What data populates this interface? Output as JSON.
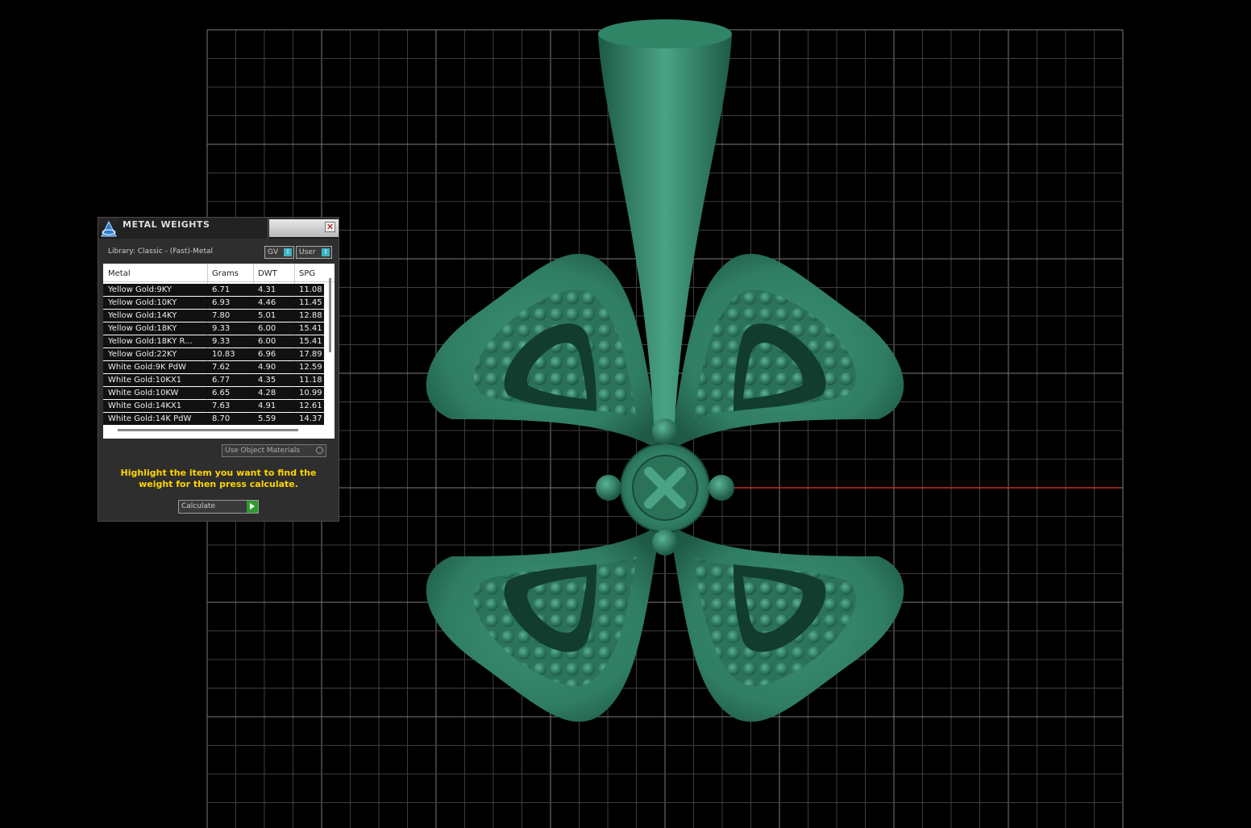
{
  "panel": {
    "title": "METAL WEIGHTS",
    "library": "Library: Classic - (Fast)-Metal",
    "toggle_gv": "GV",
    "toggle_user": "User",
    "toggle_mark": "I",
    "use_object_materials": "Use Object Materials",
    "hint": "Highlight the item you want to find the weight for then press calculate.",
    "calculate": "Calculate",
    "close": "✕"
  },
  "table": {
    "columns": [
      "Metal",
      "Grams",
      "DWT",
      "SPG"
    ],
    "rows": [
      [
        "Yellow Gold:9KY",
        "6.71",
        "4.31",
        "11.08"
      ],
      [
        "Yellow Gold:10KY",
        "6.93",
        "4.46",
        "11.45"
      ],
      [
        "Yellow Gold:14KY",
        "7.80",
        "5.01",
        "12.88"
      ],
      [
        "Yellow Gold:18KY",
        "9.33",
        "6.00",
        "15.41"
      ],
      [
        "Yellow Gold:18KY R...",
        "9.33",
        "6.00",
        "15.41"
      ],
      [
        "Yellow Gold:22KY",
        "10.83",
        "6.96",
        "17.89"
      ],
      [
        "White Gold:9K PdW",
        "7.62",
        "4.90",
        "12.59"
      ],
      [
        "White Gold:10KX1",
        "6.77",
        "4.35",
        "11.18"
      ],
      [
        "White Gold:10KW",
        "6.65",
        "4.28",
        "10.99"
      ],
      [
        "White Gold:14KX1",
        "7.63",
        "4.91",
        "12.61"
      ],
      [
        "White Gold:14K PdW",
        "8.70",
        "5.59",
        "14.37"
      ]
    ]
  },
  "colors": {
    "model_green": "#2f7d62",
    "grid": "#5a5a5a",
    "axis": "#c0321e",
    "hint_text": "#ffd400",
    "toggle_accent": "#3cb4c4"
  }
}
